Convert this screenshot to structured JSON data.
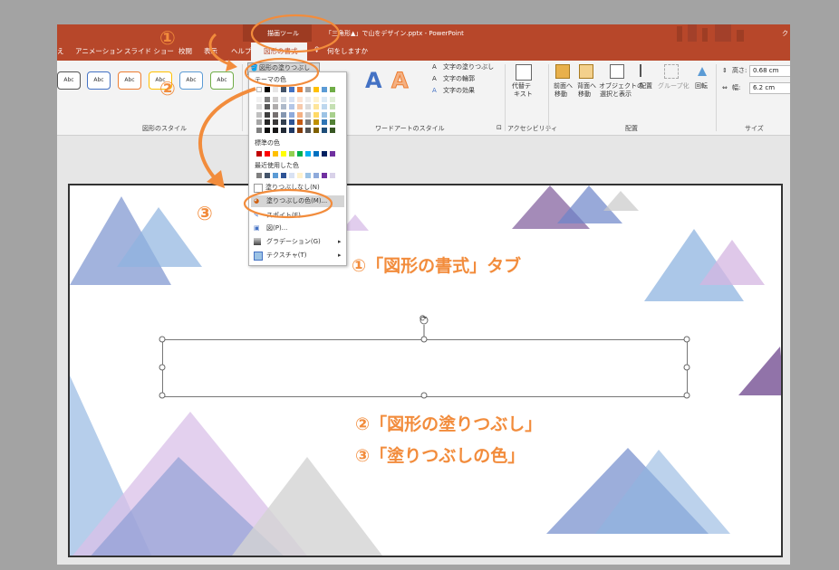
{
  "window": {
    "context_tool": "描画ツール",
    "title": "「三角形▲」で山をデザイン.pptx - PowerPoint"
  },
  "tabs": [
    "え",
    "アニメーション",
    "スライド ショー",
    "校閲",
    "表示",
    "ヘルプ",
    "図形の書式"
  ],
  "active_tab": "図形の書式",
  "tell_me": "何をしますか",
  "ribbon": {
    "shape_style_label": "Abc",
    "shape_styles_group": "図形のスタイル",
    "fill_button": "図形の塗りつぶし",
    "text_fill": "文字の塗りつぶし",
    "text_outline": "文字の輪郭",
    "text_effects": "文字の効果",
    "wordart_group": "ワードアートのスタイル",
    "alt_text": "代替テ キスト",
    "alt_text_line1": "代替テ",
    "alt_text_line2": "キスト",
    "accessibility_group": "アクセシビリティ",
    "bring_forward_1": "前面へ",
    "bring_forward_2": "移動",
    "send_backward_1": "背面へ",
    "send_backward_2": "移動",
    "selection_pane_1": "オブジェクトの",
    "selection_pane_2": "選択と表示",
    "align": "配置",
    "group": "グループ化",
    "rotate": "回転",
    "arrange_group": "配置",
    "height_label": "高さ:",
    "height_value": "0.68 cm",
    "width_label": "幅:",
    "width_value": "6.2 cm",
    "size_group": "サイズ"
  },
  "fill_menu": {
    "theme_colors": "テーマの色",
    "standard_colors": "標準の色",
    "recent_colors": "最近使用した色",
    "no_fill": "塗りつぶしなし(N)",
    "more_colors": "塗りつぶしの色(M)...",
    "eyedropper": "スポイト(E)",
    "picture": "図(P)...",
    "gradient": "グラデーション(G)",
    "texture": "テクスチャ(T)",
    "theme_rows": [
      [
        "#ffffff",
        "#000000",
        "#e7e6e6",
        "#44546a",
        "#4472c4",
        "#ed7d31",
        "#a5a5a5",
        "#ffc000",
        "#5b9bd5",
        "#70ad47"
      ],
      [
        "#f2f2f2",
        "#7f7f7f",
        "#d0cece",
        "#d6dce4",
        "#d9e2f3",
        "#fbe4d5",
        "#ededed",
        "#fff2cc",
        "#deebf6",
        "#e2efd9"
      ],
      [
        "#d8d8d8",
        "#595959",
        "#aeabab",
        "#adb9ca",
        "#b4c6e7",
        "#f7caac",
        "#dbdbdb",
        "#fee599",
        "#bdd7ee",
        "#c5e0b3"
      ],
      [
        "#bfbfbf",
        "#3f3f3f",
        "#757070",
        "#8496b0",
        "#8eaadb",
        "#f4b183",
        "#c9c9c9",
        "#ffd965",
        "#9cc3e5",
        "#a8d08d"
      ],
      [
        "#a5a5a5",
        "#262626",
        "#3a3838",
        "#323f4f",
        "#2f5496",
        "#c55a11",
        "#7b7b7b",
        "#bf9000",
        "#2e75b5",
        "#538135"
      ],
      [
        "#7f7f7f",
        "#0c0c0c",
        "#171616",
        "#222a35",
        "#1f3864",
        "#833c0b",
        "#525252",
        "#7f6000",
        "#1e4e79",
        "#375623"
      ]
    ],
    "standard_row": [
      "#c00000",
      "#ff0000",
      "#ffc000",
      "#ffff00",
      "#92d050",
      "#00b050",
      "#00b0f0",
      "#0070c0",
      "#002060",
      "#7030a0"
    ],
    "recent_row": [
      "#7f7f7f",
      "#44546a",
      "#5b9bd5",
      "#2f5496",
      "#d9e2f3",
      "#fff2cc",
      "#9cc3e5",
      "#8eaadb",
      "#7030a0",
      "#d9d2e9"
    ]
  },
  "annotations": {
    "num1": "①",
    "num2": "②",
    "num3": "③",
    "step1": "①「図形の書式」タブ",
    "step2": "②「図形の塗りつぶし」",
    "step3": "③「塗りつぶしの色」"
  },
  "colors": {
    "accent": "#b7472a",
    "annotation": "#f28c3c"
  }
}
